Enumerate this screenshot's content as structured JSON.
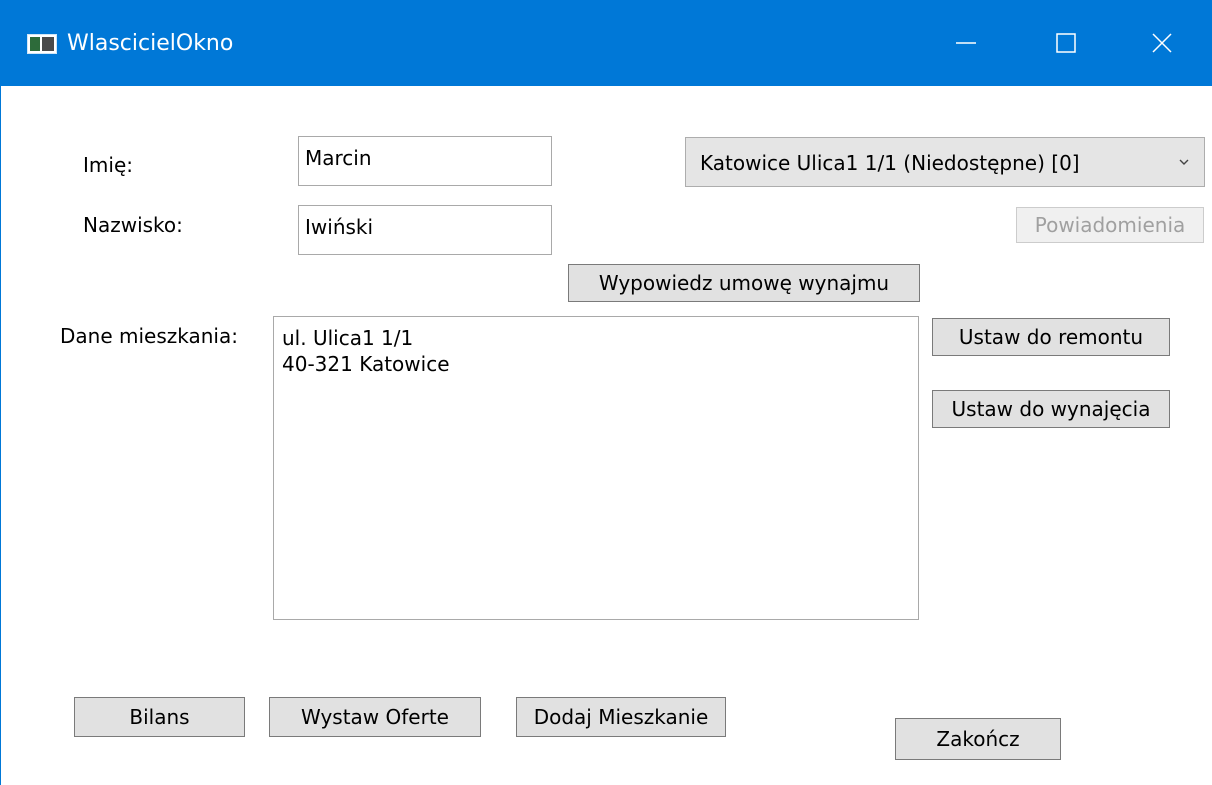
{
  "window": {
    "title": "WlascicielOkno",
    "title_color": "#ffffff",
    "titlebar_bg": "#0078d7"
  },
  "controls": {
    "minimize_icon": "minimize-icon",
    "maximize_icon": "maximize-icon",
    "close_icon": "close-icon"
  },
  "form": {
    "first_name_label": "Imię:",
    "first_name_value": "Marcin",
    "last_name_label": "Nazwisko:",
    "last_name_value": "Iwiński",
    "apartment_select_value": "Katowice Ulica1 1/1 (Niedostępne) [0]",
    "notifications_label": "Powiadomienia",
    "terminate_lease_label": "Wypowiedz umowę wynajmu",
    "apartment_data_label": "Dane mieszkania:",
    "apartment_details": {
      "line1": "ul. Ulica1 1/1",
      "line2": "40-321 Katowice"
    },
    "set_renovation_label": "Ustaw do remontu",
    "set_for_rent_label": "Ustaw do wynajęcia"
  },
  "footer": {
    "balance_label": "Bilans",
    "post_offer_label": "Wystaw Oferte",
    "add_apartment_label": "Dodaj Mieszkanie",
    "finish_label": "Zakończ"
  }
}
